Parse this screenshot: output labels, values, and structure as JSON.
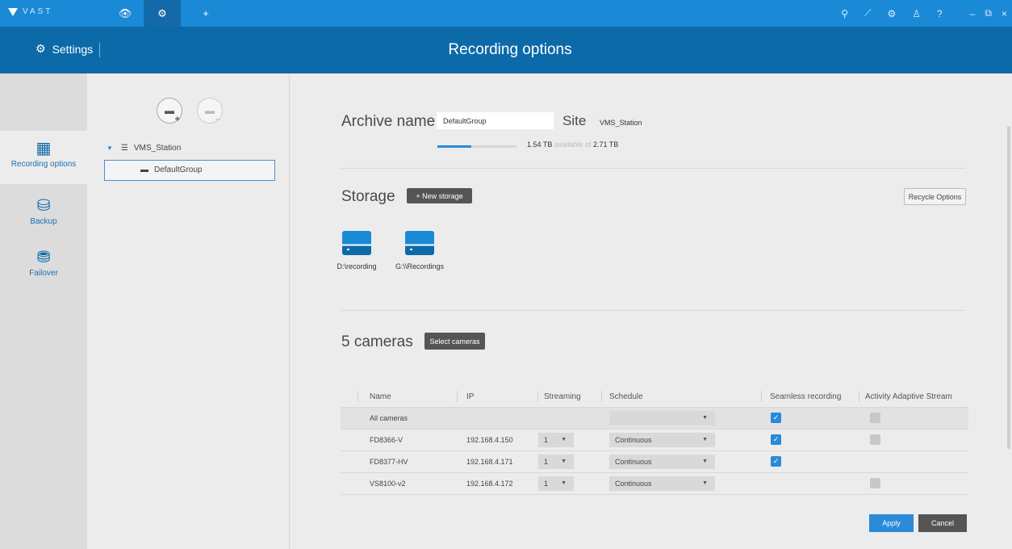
{
  "topbar": {
    "brand": "VAST",
    "tabs": [
      {
        "icon": "eye-icon",
        "glyph": "👁"
      },
      {
        "icon": "gear-icon",
        "glyph": "⚙"
      },
      {
        "icon": "plus-icon",
        "glyph": "+"
      }
    ],
    "right_icons": [
      "binoculars-icon",
      "chart-icon",
      "gear-icon",
      "person-icon",
      "help-icon",
      "minimize-icon",
      "restore-icon",
      "close-icon"
    ],
    "right_glyphs": [
      "⚲",
      "⟋",
      "⚙",
      "♙",
      "?",
      "–",
      "⧉",
      "×"
    ]
  },
  "header": {
    "settings_label": "Settings",
    "title": "Recording options"
  },
  "leftnav": {
    "items": [
      {
        "label": "Recording options",
        "icon": "calendar-icon",
        "glyph": "▦",
        "active": true
      },
      {
        "label": "Backup",
        "icon": "drive-export-icon",
        "glyph": "⛁",
        "active": false
      },
      {
        "label": "Failover",
        "icon": "server-failover-icon",
        "glyph": "⛃",
        "active": false
      }
    ]
  },
  "tree": {
    "root": "VMS_Station",
    "child": "DefaultGroup"
  },
  "archive": {
    "title": "Archive name",
    "name_value": "DefaultGroup",
    "site_label": "Site",
    "site_value": "VMS_Station",
    "used": "1.54 TB",
    "available_text": "available of",
    "total": "2.71 TB",
    "usage_fraction": 0.43
  },
  "storage": {
    "title": "Storage",
    "new_button": "+ New storage",
    "recycle_button": "Recycle Options",
    "items": [
      "D:\\recording",
      "G:\\\\Recordings"
    ]
  },
  "cameras": {
    "title": "5 cameras",
    "select_button": "Select cameras",
    "columns": [
      "Name",
      "IP",
      "Streaming",
      "Schedule",
      "Seamless recording",
      "Activity Adaptive Stream"
    ],
    "rows": [
      {
        "name": "All cameras",
        "ip": "",
        "streaming": "",
        "schedule": "",
        "seamless": true,
        "adaptive": false,
        "show_adaptive": true
      },
      {
        "name": "FD8366-V",
        "ip": "192.168.4.150",
        "streaming": "1",
        "schedule": "Continuous",
        "seamless": true,
        "adaptive": false,
        "show_adaptive": true
      },
      {
        "name": "FD8377-HV",
        "ip": "192.168.4.171",
        "streaming": "1",
        "schedule": "Continuous",
        "seamless": true,
        "adaptive": null,
        "show_adaptive": false
      },
      {
        "name": "VS8100-v2",
        "ip": "192.168.4.172",
        "streaming": "1",
        "schedule": "Continuous",
        "seamless": null,
        "adaptive": false,
        "show_adaptive": true
      }
    ]
  },
  "footer": {
    "apply": "Apply",
    "cancel": "Cancel"
  },
  "colors": {
    "topbar": "#1b8ad6",
    "header": "#0d6aa8",
    "accent": "#2a8ad8"
  }
}
